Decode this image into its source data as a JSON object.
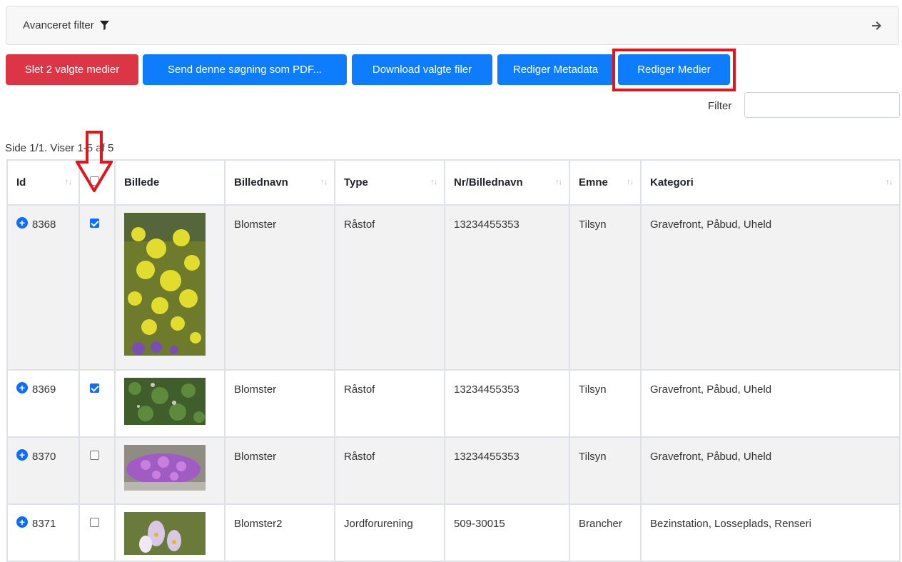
{
  "filter_bar": {
    "label": "Avanceret filter"
  },
  "actions": {
    "delete": "Slet 2 valgte medier",
    "send_pdf": "Send denne søgning som PDF...",
    "download": "Download valgte filer",
    "edit_metadata": "Rediger Metadata",
    "edit_media": "Rediger Medier"
  },
  "filter": {
    "label": "Filter",
    "value": ""
  },
  "pagination": {
    "text": "Side 1/1. Viser 1-5 af 5"
  },
  "table": {
    "headers": {
      "id": "Id",
      "image": "Billede",
      "name": "Billednavn",
      "type": "Type",
      "nr": "Nr/Billednavn",
      "subject": "Emne",
      "category": "Kategori"
    },
    "rows": [
      {
        "id": "8368",
        "checked": true,
        "name": "Blomster",
        "type": "Råstof",
        "nr": "13234455353",
        "subject": "Tilsyn",
        "category": "Gravefront, Påbud, Uheld"
      },
      {
        "id": "8369",
        "checked": true,
        "name": "Blomster",
        "type": "Råstof",
        "nr": "13234455353",
        "subject": "Tilsyn",
        "category": "Gravefront, Påbud, Uheld"
      },
      {
        "id": "8370",
        "checked": false,
        "name": "Blomster",
        "type": "Råstof",
        "nr": "13234455353",
        "subject": "Tilsyn",
        "category": "Gravefront, Påbud, Uheld"
      },
      {
        "id": "8371",
        "checked": false,
        "name": "Blomster2",
        "type": "Jordforurening",
        "nr": "509-30015",
        "subject": "Brancher",
        "category": "Bezinstation, Losseplads, Renseri"
      }
    ]
  },
  "colors": {
    "primary": "#0d7dfd",
    "danger": "#dc3545",
    "annotation": "#e3141b"
  },
  "icons": {
    "filter": "funnel-icon",
    "expand": "arrow-right-icon",
    "row_expand": "plus-circle-icon",
    "sort": "sort-arrows-icon"
  }
}
